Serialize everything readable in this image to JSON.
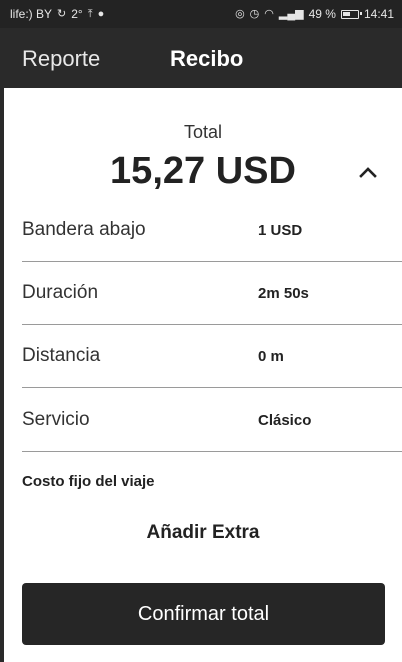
{
  "status_bar": {
    "carrier": "life:) BY",
    "signal_extra": "2°",
    "battery_percent": "49 %",
    "time": "14:41",
    "icons": [
      "sync-icon",
      "upload-icon",
      "message-icon",
      "location-icon",
      "alarm-icon",
      "wifi-icon",
      "signal-icon",
      "battery-icon"
    ]
  },
  "topbar": {
    "tabs": [
      {
        "label": "Reporte",
        "active": false
      },
      {
        "label": "Recibo",
        "active": true
      }
    ]
  },
  "receipt": {
    "total_label": "Total",
    "total_amount": "15,27 USD",
    "collapse_icon": "chevron-up-icon",
    "rows": [
      {
        "label": "Bandera abajo",
        "value": "1 USD"
      },
      {
        "label": "Duración",
        "value": "2m 50s"
      },
      {
        "label": "Distancia",
        "value": "0 m"
      },
      {
        "label": "Servicio",
        "value": "Clásico"
      }
    ],
    "fixed_cost_label": "Costo fijo del viaje",
    "add_extra_label": "Añadir Extra",
    "confirm_label": "Confirmar total"
  },
  "colors": {
    "topbar_bg": "#2a2a2a",
    "status_bg": "#232323",
    "button_bg": "#262626",
    "divider": "#9a9a9a"
  }
}
